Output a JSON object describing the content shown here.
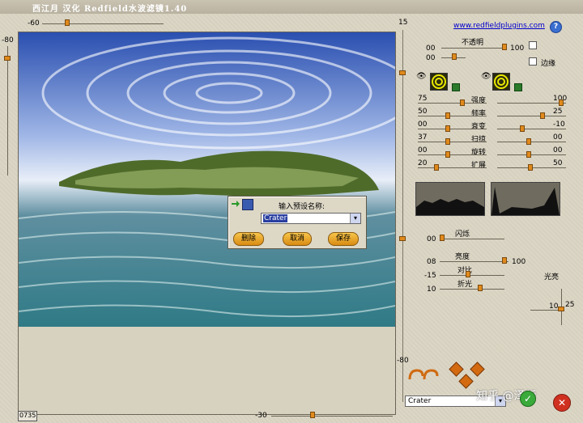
{
  "title": "西江月 汉化 Redfield水波滤镜1.40",
  "top_slider_value": "-60",
  "left_slider_value": "-80",
  "right_top_value": "15",
  "right_bottom_value": "-80",
  "bottom_slider_value": "-30",
  "status_box": "0735",
  "site_link": "www.redfieldplugins.com",
  "help_icon": "?",
  "opacity": {
    "label": "不透明",
    "v1": "00",
    "v1_max": "100",
    "v2": "00"
  },
  "edge_label": "边缘",
  "params": [
    {
      "left": "75",
      "label": "强度",
      "right": "100"
    },
    {
      "left": "50",
      "label": "频率",
      "right": "25"
    },
    {
      "left": "00",
      "label": "衰变",
      "right": "-10"
    },
    {
      "left": "37",
      "label": "扫掠",
      "right": "00"
    },
    {
      "left": "00",
      "label": "旋转",
      "right": "00"
    },
    {
      "left": "20",
      "label": "扩展",
      "right": "50"
    }
  ],
  "flicker": {
    "label": "闪烁",
    "value": "00"
  },
  "brightness": {
    "label": "亮度",
    "value": "08",
    "max": "100"
  },
  "contrast": {
    "label": "对比",
    "value": "-15"
  },
  "refraction": {
    "label": "折光",
    "value": "10"
  },
  "glow": {
    "label": "光亮",
    "v1": "10",
    "v2": "25"
  },
  "preset_select": "Crater",
  "dialog": {
    "title": "输入预设名称:",
    "input_value": "Crater",
    "delete_label": "删除",
    "cancel_label": "取消",
    "save_label": "保存"
  },
  "watermark": "知乎 @泽新"
}
